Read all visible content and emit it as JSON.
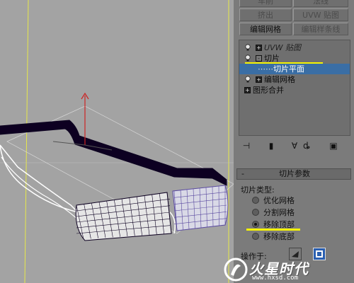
{
  "panel": {
    "buttons": {
      "top_left": "车削",
      "top_right": "法线",
      "extrude": "挤出",
      "uvw_map": "UVW 贴图",
      "edit_mesh": "编辑网格",
      "edit_spline": "编辑样条线"
    },
    "stack": {
      "items": [
        {
          "label": "UVW 贴图",
          "expander": "+"
        },
        {
          "label": "切片",
          "expander": "-"
        },
        {
          "label": "切片平面",
          "expander": ""
        },
        {
          "label": "编辑网格",
          "expander": "+"
        },
        {
          "label": "图形合并",
          "expander": "+"
        }
      ]
    },
    "rollout": {
      "collapse_symbol": "-",
      "title": "切片参数",
      "slice_type_label": "切片类型:",
      "options": [
        "优化网格",
        "分割网格",
        "移除顶部",
        "移除底部"
      ],
      "selected_option": "移除顶部",
      "operate_on_label": "操作于:"
    }
  },
  "watermark": {
    "brand": "火星时代",
    "url": "www.hxsd.com"
  },
  "colors": {
    "viewport_bg": "#a3a3a3",
    "panel_bg": "#7b7b7b",
    "highlight_line": "#f7f300",
    "selected_row": "#3a6ea5",
    "mesh_outline": "#0d0021",
    "mesh_face": "#ffffff",
    "gizmo_red": "#cc2222"
  }
}
